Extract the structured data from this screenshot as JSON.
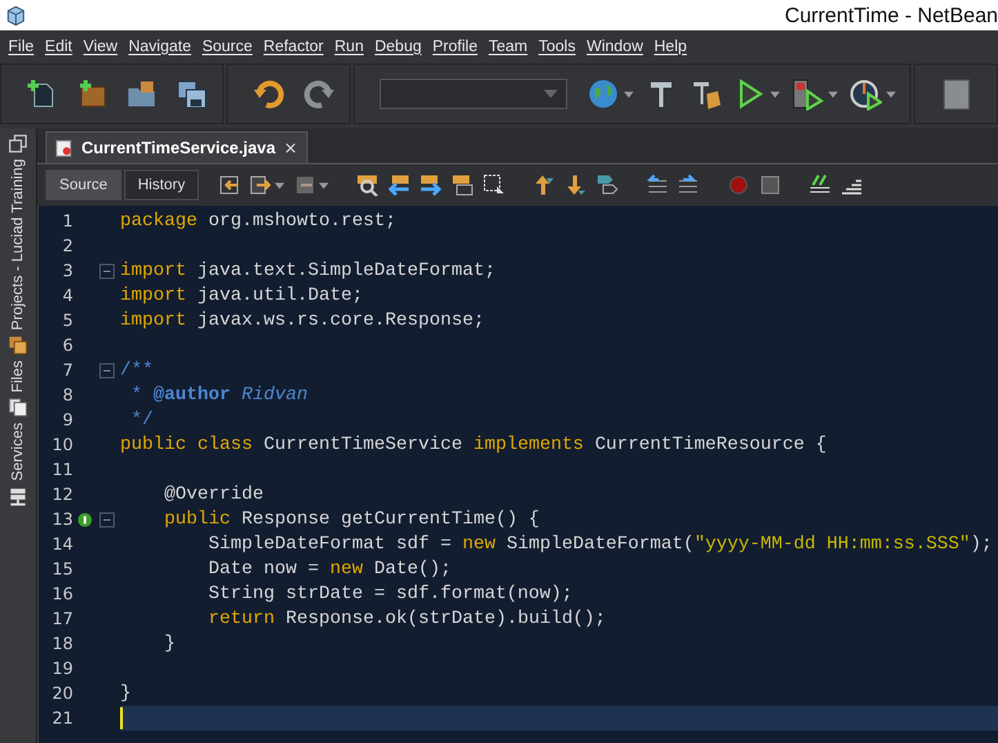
{
  "window": {
    "title": "CurrentTime - NetBean"
  },
  "menu": [
    "File",
    "Edit",
    "View",
    "Navigate",
    "Source",
    "Refactor",
    "Run",
    "Debug",
    "Profile",
    "Team",
    "Tools",
    "Window",
    "Help"
  ],
  "side_tabs": [
    "Projects - Luciad Training",
    "Files",
    "Services"
  ],
  "editor_tabs": [
    {
      "label": "CurrentTimeService.java",
      "close": "×",
      "selected": true
    }
  ],
  "view_buttons": [
    {
      "label": "Source",
      "selected": true
    },
    {
      "label": "History",
      "selected": false
    }
  ],
  "code": [
    {
      "number": "1",
      "fold": false,
      "marker": false,
      "current": false,
      "tokens": [
        {
          "kind": "kw",
          "text": "package "
        },
        {
          "kind": "id",
          "text": "org.mshowto.rest;"
        }
      ]
    },
    {
      "number": "2",
      "fold": false,
      "marker": false,
      "current": false
    },
    {
      "number": "3",
      "fold": true,
      "marker": false,
      "current": false,
      "tokens": [
        {
          "kind": "kw",
          "text": "import "
        },
        {
          "kind": "id",
          "text": "java.text.SimpleDateFormat;"
        }
      ]
    },
    {
      "number": "4",
      "fold": false,
      "marker": false,
      "current": false,
      "tokens": [
        {
          "kind": "kw",
          "text": "import "
        },
        {
          "kind": "id",
          "text": "java.util.Date;"
        }
      ]
    },
    {
      "number": "5",
      "fold": false,
      "marker": false,
      "current": false,
      "tokens": [
        {
          "kind": "kw",
          "text": "import "
        },
        {
          "kind": "id",
          "text": "javax.ws.rs.core.Response;"
        }
      ]
    },
    {
      "number": "6",
      "fold": false,
      "marker": false,
      "current": false
    },
    {
      "number": "7",
      "fold": true,
      "marker": false,
      "current": false,
      "tokens": [
        {
          "kind": "comment",
          "text": "/**"
        }
      ]
    },
    {
      "number": "8",
      "fold": false,
      "marker": false,
      "current": false,
      "tokens": [
        {
          "kind": "comment",
          "text": " * "
        },
        {
          "kind": "doctag",
          "text": "@author "
        },
        {
          "kind": "docitalic",
          "text": "Ridvan"
        }
      ]
    },
    {
      "number": "9",
      "fold": false,
      "marker": false,
      "current": false,
      "tokens": [
        {
          "kind": "comment",
          "text": " */"
        }
      ]
    },
    {
      "number": "10",
      "fold": false,
      "marker": false,
      "current": false,
      "tokens": [
        {
          "kind": "kw",
          "text": "public class "
        },
        {
          "kind": "id",
          "text": "CurrentTimeService "
        },
        {
          "kind": "kw",
          "text": "implements "
        },
        {
          "kind": "id",
          "text": "CurrentTimeResource {"
        }
      ]
    },
    {
      "number": "11",
      "fold": false,
      "marker": false,
      "current": false
    },
    {
      "number": "12",
      "fold": false,
      "marker": false,
      "current": false,
      "tokens": [
        {
          "kind": "id",
          "text": "    @Override"
        }
      ]
    },
    {
      "number": "13",
      "fold": true,
      "marker": true,
      "current": false,
      "tokens": [
        {
          "kind": "kw",
          "text": "    public "
        },
        {
          "kind": "id",
          "text": "Response getCurrentTime() {"
        }
      ]
    },
    {
      "number": "14",
      "fold": false,
      "marker": false,
      "current": false,
      "tokens": [
        {
          "kind": "id",
          "text": "        SimpleDateFormat sdf = "
        },
        {
          "kind": "kw",
          "text": "new "
        },
        {
          "kind": "id",
          "text": "SimpleDateFormat("
        },
        {
          "kind": "str",
          "text": "\"yyyy-MM-dd HH:mm:ss.SSS\""
        },
        {
          "kind": "id",
          "text": ");"
        }
      ]
    },
    {
      "number": "15",
      "fold": false,
      "marker": false,
      "current": false,
      "tokens": [
        {
          "kind": "id",
          "text": "        Date now = "
        },
        {
          "kind": "kw",
          "text": "new "
        },
        {
          "kind": "id",
          "text": "Date();"
        }
      ]
    },
    {
      "number": "16",
      "fold": false,
      "marker": false,
      "current": false,
      "tokens": [
        {
          "kind": "id",
          "text": "        String strDate = sdf.format(now);"
        }
      ]
    },
    {
      "number": "17",
      "fold": false,
      "marker": false,
      "current": false,
      "tokens": [
        {
          "kind": "kw",
          "text": "        return "
        },
        {
          "kind": "id",
          "text": "Response.ok(strDate).build();"
        }
      ]
    },
    {
      "number": "18",
      "fold": false,
      "marker": false,
      "current": false,
      "tokens": [
        {
          "kind": "id",
          "text": "    }"
        }
      ]
    },
    {
      "number": "19",
      "fold": false,
      "marker": false,
      "current": false
    },
    {
      "number": "20",
      "fold": false,
      "marker": false,
      "current": false,
      "tokens": [
        {
          "kind": "id",
          "text": "}"
        }
      ]
    },
    {
      "number": "21",
      "fold": false,
      "marker": false,
      "current": true
    }
  ]
}
